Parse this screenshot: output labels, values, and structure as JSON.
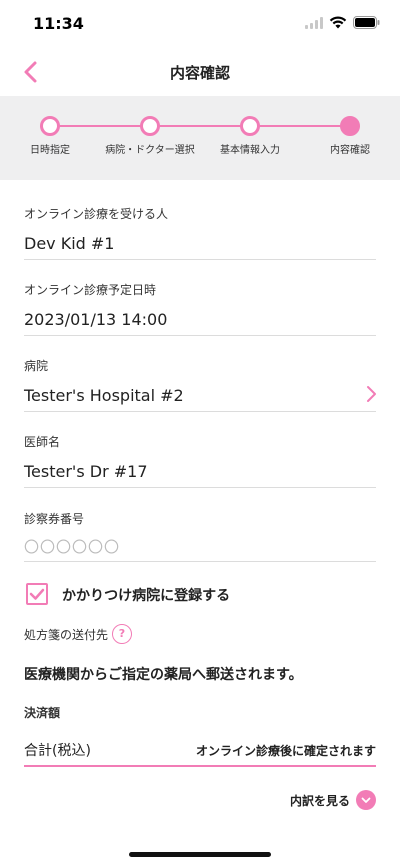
{
  "status_bar": {
    "time": "11:34"
  },
  "nav": {
    "title": "内容確認"
  },
  "steps": [
    {
      "label": "日時指定",
      "state": "done"
    },
    {
      "label": "病院・ドクター選択",
      "state": "done"
    },
    {
      "label": "基本情報入力",
      "state": "done"
    },
    {
      "label": "内容確認",
      "state": "active"
    }
  ],
  "fields": {
    "patient": {
      "label": "オンライン診療を受ける人",
      "value": "Dev Kid #1"
    },
    "datetime": {
      "label": "オンライン診療予定日時",
      "value": "2023/01/13 14:00"
    },
    "hospital": {
      "label": "病院",
      "value": "Tester's Hospital #2"
    },
    "doctor": {
      "label": "医師名",
      "value": "Tester's Dr #17"
    },
    "ticket": {
      "label": "診察券番号",
      "placeholder": "〇〇〇〇〇〇"
    }
  },
  "family_hospital": {
    "label": "かかりつけ病院に登録する",
    "checked": true
  },
  "prescription": {
    "label": "処方箋の送付先",
    "help": "?",
    "text": "医療機関からご指定の薬局へ郵送されます。"
  },
  "payment": {
    "label": "決済額",
    "total_label": "合計(税込)",
    "total_value": "オンライン診療後に確定されます",
    "details_label": "内訳を見る"
  },
  "colors": {
    "accent": "#f27cb6",
    "stepper_bg": "#efeff0"
  }
}
